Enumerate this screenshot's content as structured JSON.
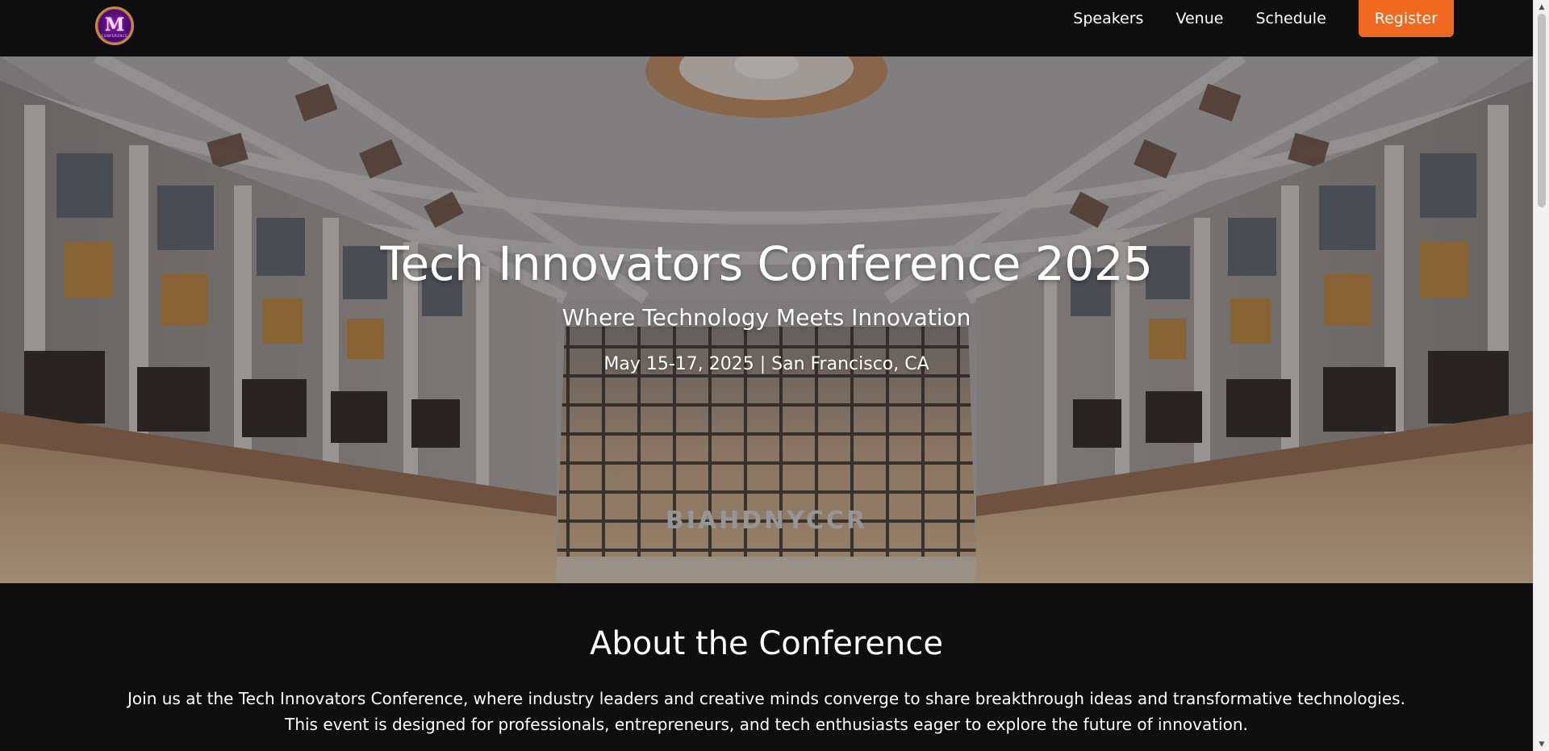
{
  "nav": {
    "logo_letter": "M",
    "logo_sub": "CONFERENCE",
    "links": [
      {
        "label": "Speakers"
      },
      {
        "label": "Venue"
      },
      {
        "label": "Schedule"
      }
    ],
    "register_label": "Register",
    "register_color": "#ef6a20"
  },
  "hero": {
    "title": "Tech Innovators Conference 2025",
    "subtitle": "Where Technology Meets Innovation",
    "date_location": "May 15-17, 2025 | San Francisco, CA",
    "background_image": "atrium-interior-photo",
    "building_inscription": "BIAHDNYCCR"
  },
  "about": {
    "title": "About the Conference",
    "text": "Join us at the Tech Innovators Conference, where industry leaders and creative minds converge to share breakthrough ideas and transformative technologies. This event is designed for professionals, entrepreneurs, and tech enthusiasts eager to explore the future of innovation."
  },
  "colors": {
    "page_background": "#0e0e0e",
    "accent": "#ef6a20",
    "text": "#ffffff"
  },
  "scrollbar": {
    "up_icon": "triangle-up-icon",
    "down_icon": "triangle-down-icon"
  }
}
